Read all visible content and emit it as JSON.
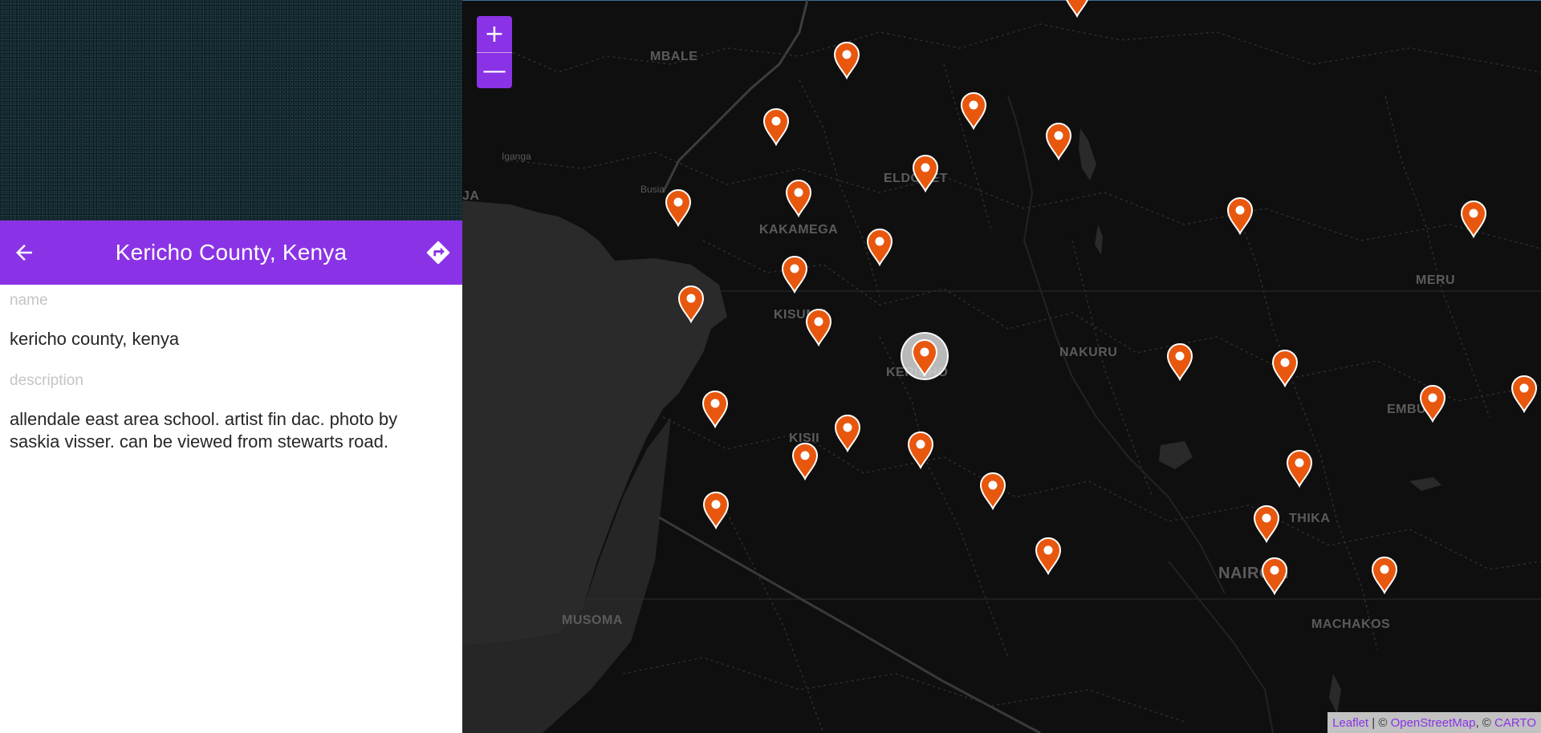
{
  "sidebar": {
    "title": "Kericho County, Kenya",
    "fields": [
      {
        "label": "name",
        "value": "kericho county, kenya"
      },
      {
        "label": "description",
        "value": "allendale east area school. artist fin dac. photo by saskia visser. can be viewed from stewarts road."
      }
    ],
    "back_icon": "arrow-left-icon",
    "directions_icon": "directions-icon"
  },
  "map": {
    "zoom_in_label": "+",
    "zoom_out_label": "—",
    "place_labels": [
      "MBALE",
      "Iganga",
      "Busia",
      "JA",
      "KAKAMEGA",
      "ELDORET",
      "KISUMU",
      "KERICHO",
      "KISII",
      "NAKURU",
      "MERU",
      "EMBU",
      "THIKA",
      "NAIROBI",
      "MACHAKOS",
      "MUSOMA"
    ],
    "marker_color": "#e8570e",
    "accent_color": "#8a33e6",
    "marker_count": 38,
    "selected_marker": "Kericho County, Kenya",
    "attribution": {
      "leaflet": "Leaflet",
      "separator": " | © ",
      "osm": "OpenStreetMap",
      "comma": ", © ",
      "carto": "CARTO"
    }
  }
}
